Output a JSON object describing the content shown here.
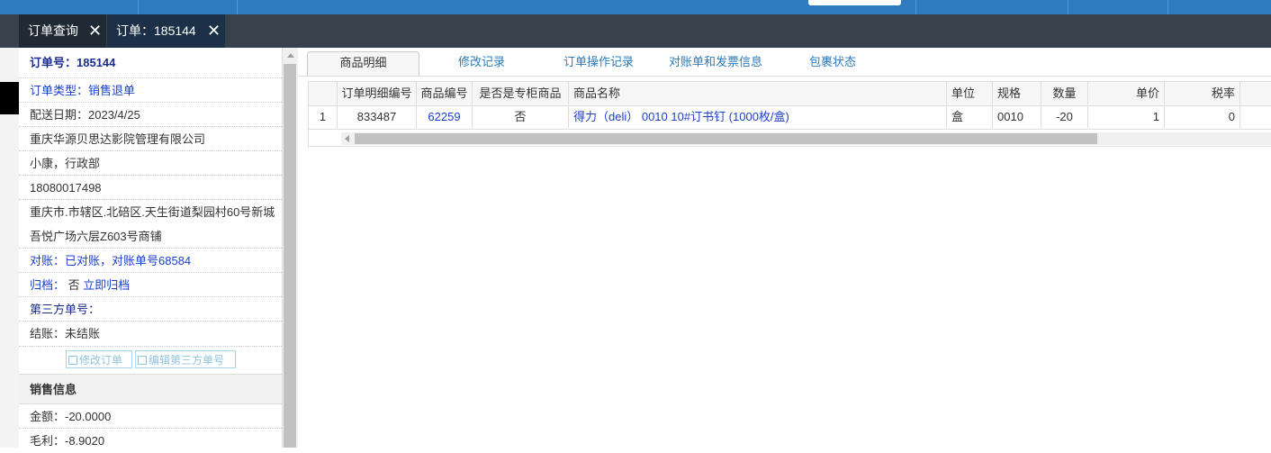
{
  "tabs": [
    {
      "label": "订单查询"
    },
    {
      "label": "订单：185144"
    }
  ],
  "order": {
    "number": "订单号：185144",
    "type": "订单类型：销售退单",
    "delivery_date": "配送日期：2023/4/25",
    "company": "重庆华源贝思达影院管理有限公司",
    "contact": "小康，行政部",
    "phone": "18080017498",
    "address_line1": "重庆市.市辖区.北碚区.天生街道梨园村60号新城",
    "address_line2": "吾悦广场六层Z603号商铺",
    "reconcile": "对账：已对账，对账单号68584",
    "archive_label": "归档：",
    "archive_value": "否",
    "archive_link": "立即归档",
    "third_party": "第三方单号：",
    "settlement": "结账：未结账",
    "edit_order_btn": "修改订单",
    "edit_third_btn": "编辑第三方单号"
  },
  "sales": {
    "header": "销售信息",
    "amount": "金额：-20.0000",
    "profit": "毛利：-8.9020"
  },
  "detail_tabs": [
    "商品明细",
    "修改记录",
    "订单操作记录",
    "对账单和发票信息",
    "包裹状态"
  ],
  "grid": {
    "headers": [
      "订单明细编号",
      "商品编号",
      "是否是专柜商品",
      "商品名称",
      "单位",
      "规格",
      "数量",
      "单价",
      "税率"
    ],
    "rows": [
      {
        "index": "1",
        "detail_id": "833487",
        "product_id": "62259",
        "is_counter": "否",
        "name": "得力（deli） 0010 10#订书钉 (1000枚/盒)",
        "unit": "盒",
        "spec": "0010",
        "qty": "-20",
        "price": "1",
        "tax": "0"
      }
    ]
  },
  "colors": {
    "topbar": "#2f7bbf",
    "tabbar": "#38424d",
    "link": "#1a3fcf"
  },
  "icons": [
    "close-icon",
    "edit-icon",
    "scroll-up-arrow-icon",
    "scroll-left-arrow-icon"
  ]
}
